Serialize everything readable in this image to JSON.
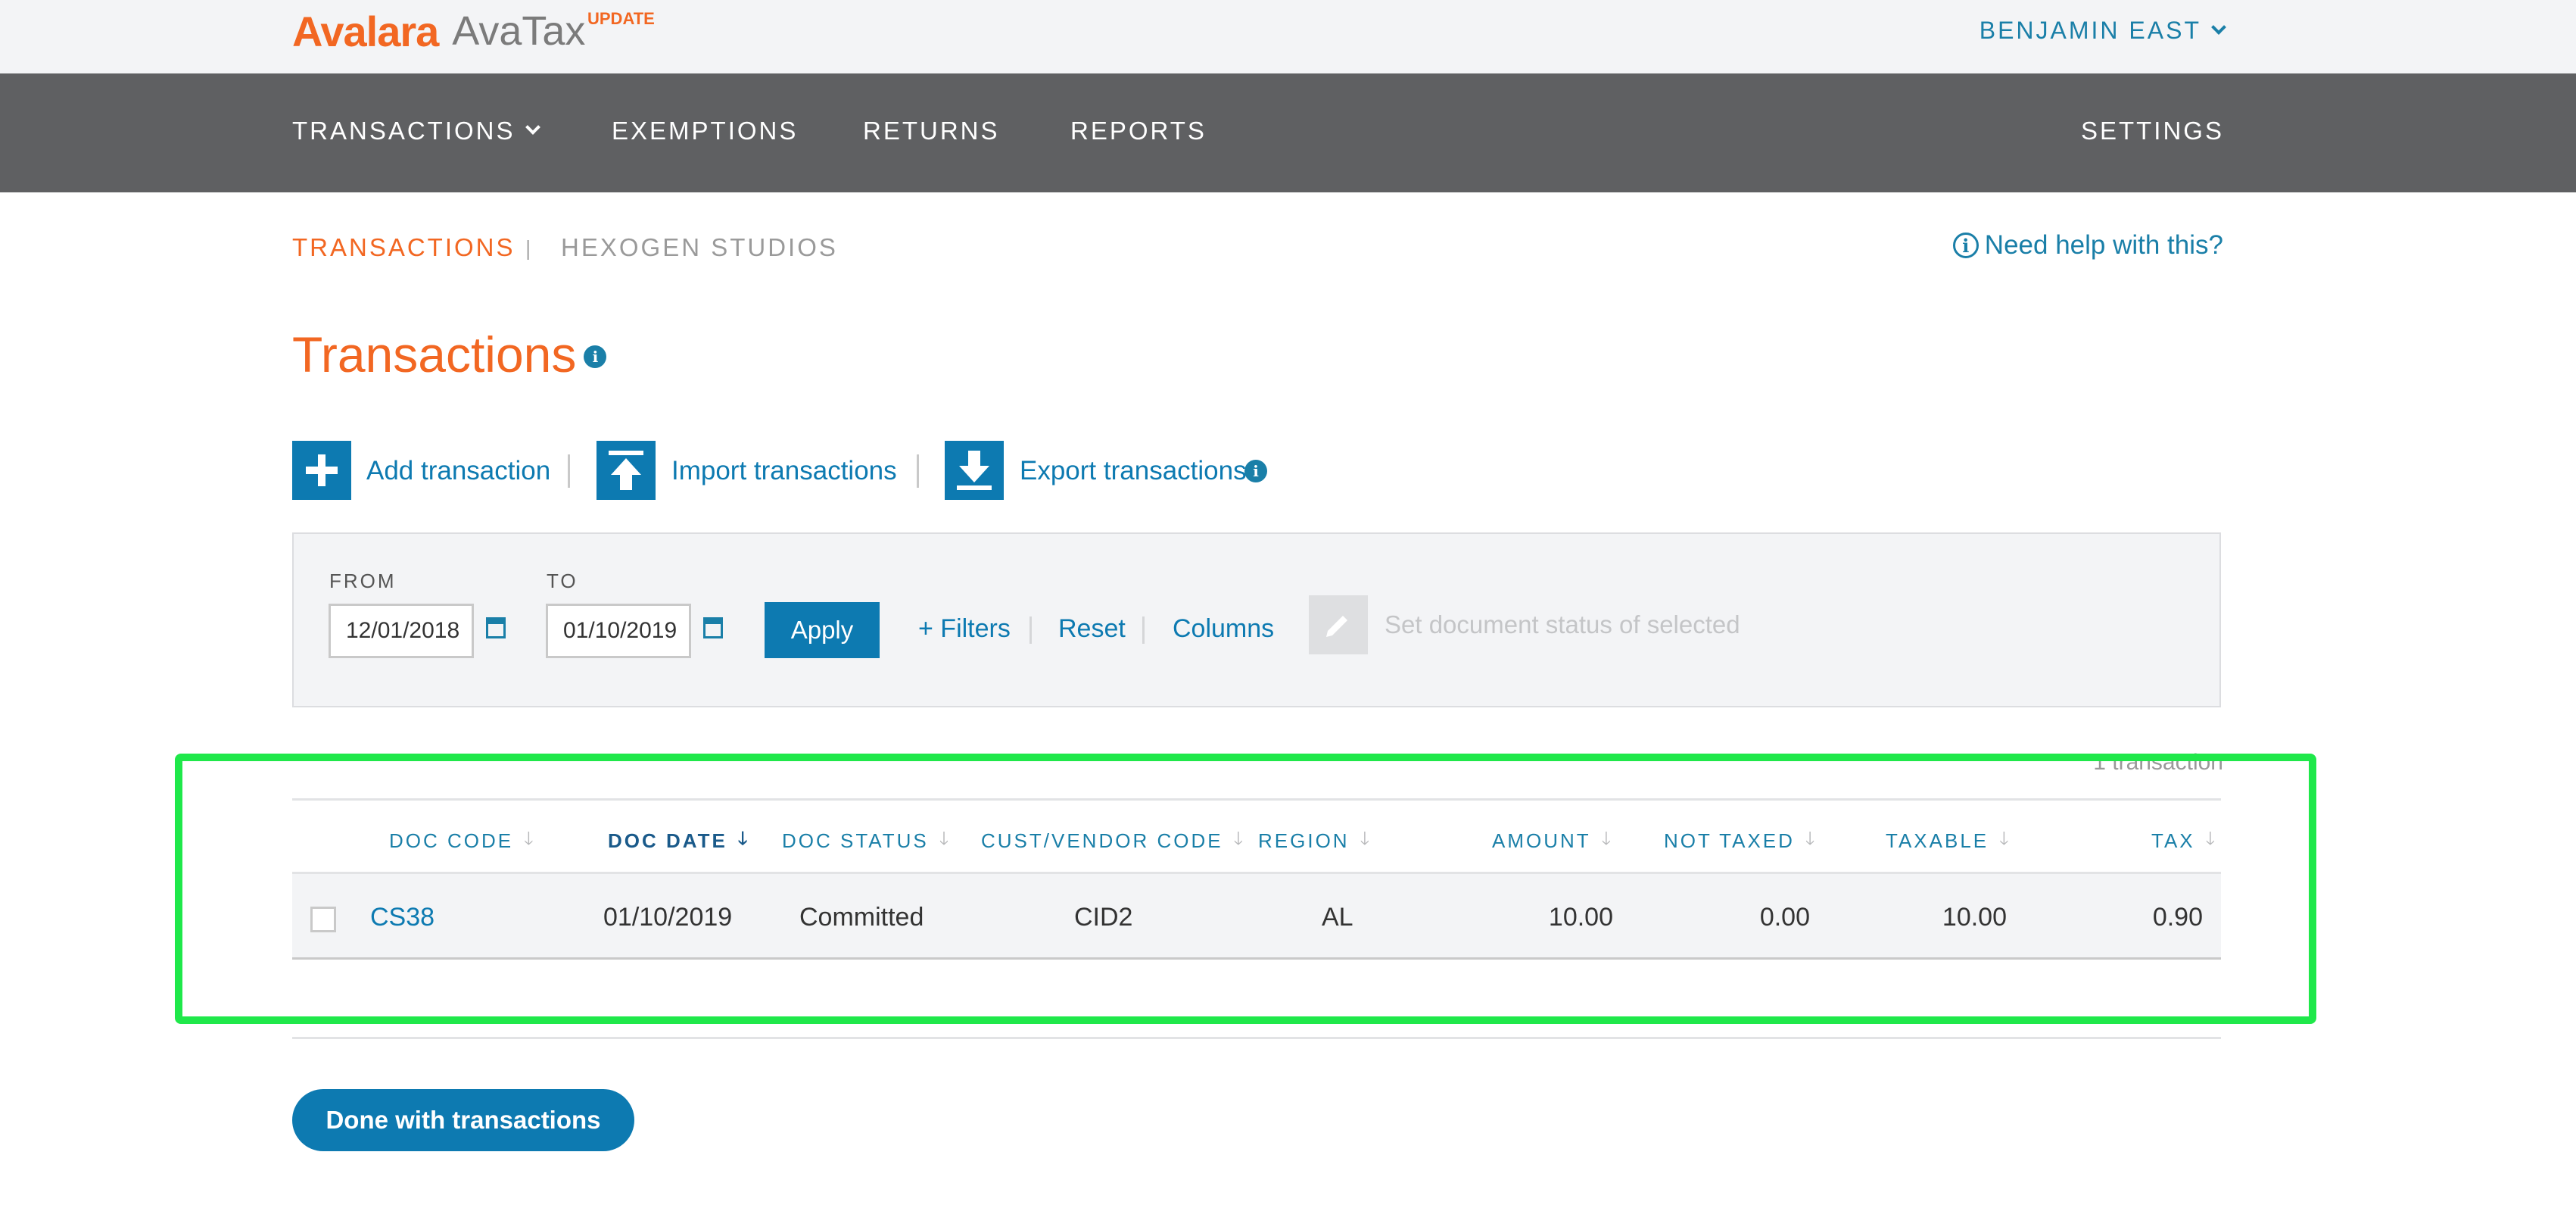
{
  "header": {
    "logo_brand": "Avalara",
    "logo_product": "AvaTax",
    "logo_badge": "UPDATE",
    "user_name": "BENJAMIN EAST"
  },
  "nav": {
    "items": [
      {
        "label": "TRANSACTIONS",
        "has_dropdown": true
      },
      {
        "label": "EXEMPTIONS"
      },
      {
        "label": "RETURNS"
      },
      {
        "label": "REPORTS"
      }
    ],
    "settings": "SETTINGS"
  },
  "breadcrumb": {
    "current": "TRANSACTIONS",
    "separator": "|",
    "company": "HEXOGEN STUDIOS"
  },
  "help_link": "Need help with this?",
  "page_title": "Transactions",
  "actions": {
    "add": "Add transaction",
    "import": "Import transactions",
    "export": "Export transactions"
  },
  "filters": {
    "from_label": "FROM",
    "from_value": "12/01/2018",
    "to_label": "TO",
    "to_value": "01/10/2019",
    "apply": "Apply",
    "more_filters": "+ Filters",
    "reset": "Reset",
    "columns": "Columns",
    "set_status": "Set document status of selected"
  },
  "result_count": "1 transaction",
  "table": {
    "columns": [
      {
        "label": "DOC CODE"
      },
      {
        "label": "DOC DATE",
        "sorted": true
      },
      {
        "label": "DOC STATUS"
      },
      {
        "label": "CUST/VENDOR CODE"
      },
      {
        "label": "REGION"
      },
      {
        "label": "AMOUNT"
      },
      {
        "label": "NOT TAXED"
      },
      {
        "label": "TAXABLE"
      },
      {
        "label": "TAX"
      }
    ],
    "rows": [
      {
        "doc_code": "CS38",
        "doc_date": "01/10/2019",
        "doc_status": "Committed",
        "cust_vendor_code": "CID2",
        "region": "AL",
        "amount": "10.00",
        "not_taxed": "0.00",
        "taxable": "10.00",
        "tax": "0.90"
      }
    ]
  },
  "done_button": "Done with transactions",
  "colors": {
    "brand_orange": "#f26722",
    "accent_blue": "#0d7ab1",
    "nav_gray": "#5f6062",
    "highlight_green": "#1fe84a"
  }
}
